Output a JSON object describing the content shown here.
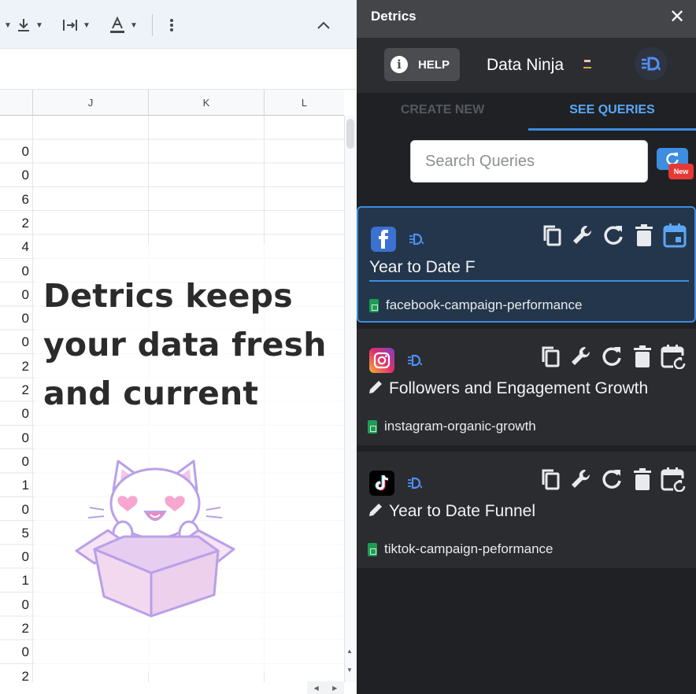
{
  "spreadsheet": {
    "columns": [
      "J",
      "K",
      "L"
    ],
    "row_values": [
      "0",
      "0",
      "6",
      "2",
      "4",
      "0",
      "0",
      "0",
      "0",
      "2",
      "2",
      "0",
      "0",
      "0",
      "1",
      "0",
      "5",
      "0",
      "1",
      "0",
      "2",
      "0",
      "2"
    ],
    "headline_lines": [
      "Detrics keeps",
      "your data fresh",
      "and current"
    ],
    "toolbar_icons": [
      "download-icon",
      "text-wrap-icon",
      "text-color-icon",
      "more-vert-icon",
      "collapse-icon"
    ]
  },
  "panel": {
    "title": "Detrics",
    "help_label": "HELP",
    "user_name": "Data Ninja",
    "tabs": {
      "create": "CREATE NEW",
      "see": "SEE QUERIES"
    },
    "search_placeholder": "Search Queries",
    "new_badge": "New",
    "accent_color": "#3d8de0",
    "queries": [
      {
        "source": "facebook",
        "title": "Year to Date F",
        "sheet": "facebook-campaign-performance",
        "editing": true
      },
      {
        "source": "instagram",
        "title": "Followers and Engagement Growth",
        "sheet": "instagram-organic-growth",
        "editing": false
      },
      {
        "source": "tiktok",
        "title": "Year to Date Funnel",
        "sheet": "tiktok-campaign-peformance",
        "editing": false
      }
    ]
  }
}
